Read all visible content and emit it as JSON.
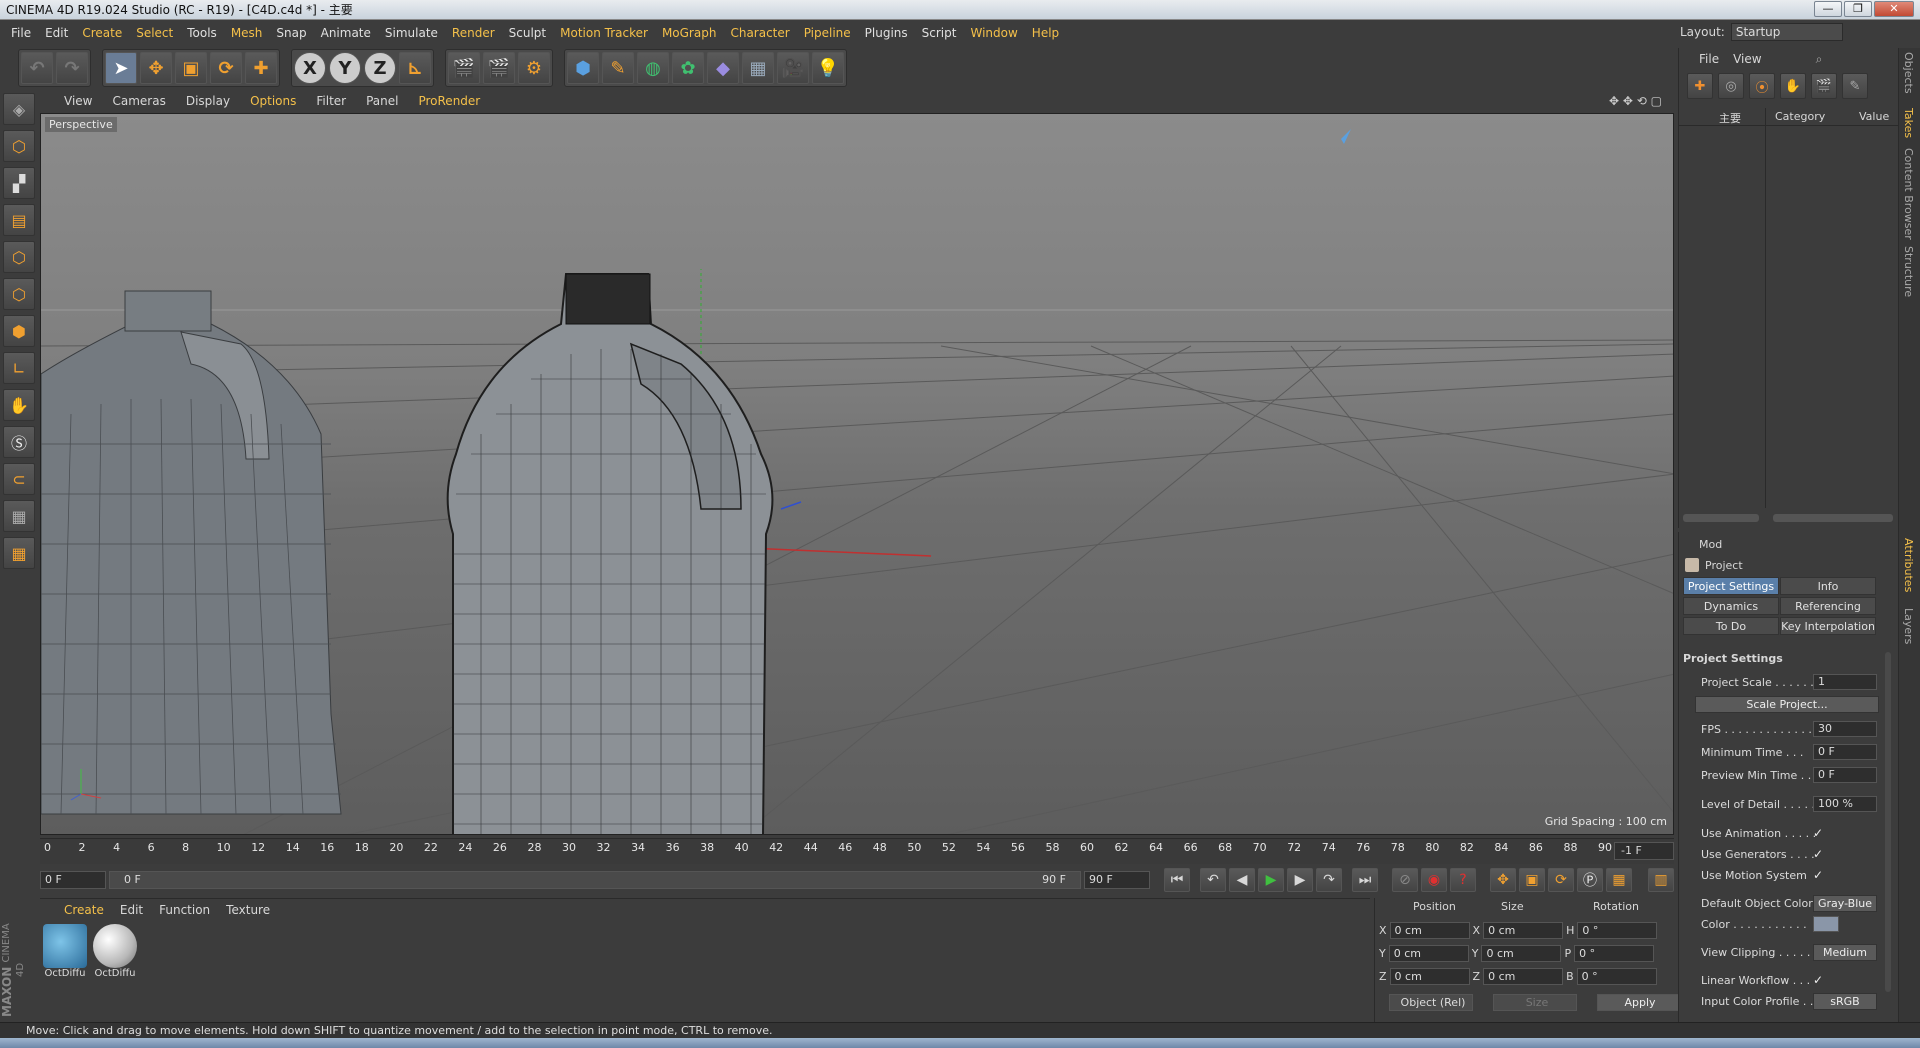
{
  "window": {
    "title": "CINEMA 4D R19.024 Studio (RC - R19) - [C4D.c4d *] - 主要",
    "buttons": [
      "—",
      "❐",
      "✕"
    ]
  },
  "menubar": {
    "items": [
      "File",
      "Edit",
      "Create",
      "Select",
      "Tools",
      "Mesh",
      "Snap",
      "Animate",
      "Simulate",
      "Render",
      "Sculpt",
      "Motion Tracker",
      "MoGraph",
      "Character",
      "Pipeline",
      "Plugins",
      "Script",
      "Window",
      "Help"
    ]
  },
  "layout": {
    "label": "Layout:",
    "value": "Startup"
  },
  "toolbar": {
    "axis_x": "X",
    "axis_y": "Y",
    "axis_z": "Z",
    "icons": [
      "undo-icon",
      "redo-icon",
      "select-icon",
      "move-icon",
      "scale-icon",
      "rotate-icon",
      "add-icon",
      "x-axis-icon",
      "y-axis-icon",
      "z-axis-icon",
      "coordinate-system-icon",
      "render-view-icon",
      "render-picture-viewer-icon",
      "render-settings-icon",
      "cube-icon",
      "pen-icon",
      "subdivision-icon",
      "cloner-icon",
      "deformer-icon",
      "floor-icon",
      "camera-icon",
      "light-icon"
    ]
  },
  "viewport": {
    "menu": [
      "View",
      "Cameras",
      "Display",
      "Options",
      "Filter",
      "Panel",
      "ProRender"
    ],
    "label": "Perspective",
    "grid_spacing": "Grid Spacing : 100 cm"
  },
  "timeline": {
    "ticks": [
      "0",
      "2",
      "4",
      "6",
      "8",
      "10",
      "12",
      "14",
      "16",
      "18",
      "20",
      "22",
      "24",
      "26",
      "28",
      "30",
      "32",
      "34",
      "36",
      "38",
      "40",
      "42",
      "44",
      "46",
      "48",
      "50",
      "52",
      "54",
      "56",
      "58",
      "60",
      "62",
      "64",
      "66",
      "68",
      "70",
      "72",
      "74",
      "76",
      "78",
      "80",
      "82",
      "84",
      "86",
      "88",
      "90"
    ],
    "current": "-1 F"
  },
  "playback": {
    "start": "0 F",
    "range_start": "0 F",
    "range_end": "90 F",
    "end": "90 F"
  },
  "material_manager": {
    "menu": [
      "Create",
      "Edit",
      "Function",
      "Texture"
    ],
    "materials": [
      {
        "name": "OctDiffu"
      },
      {
        "name": "OctDiffu"
      }
    ]
  },
  "coordinates": {
    "headers": [
      "Position",
      "Size",
      "Rotation"
    ],
    "rows": [
      {
        "axis": "X",
        "pos": "0 cm",
        "saxis": "X",
        "size": "0 cm",
        "raxis": "H",
        "rot": "0 °"
      },
      {
        "axis": "Y",
        "pos": "0 cm",
        "saxis": "Y",
        "size": "0 cm",
        "raxis": "P",
        "rot": "0 °"
      },
      {
        "axis": "Z",
        "pos": "0 cm",
        "saxis": "Z",
        "size": "0 cm",
        "raxis": "B",
        "rot": "0 °"
      }
    ],
    "mode": "Object (Rel)",
    "size_mode": "Size",
    "apply": "Apply"
  },
  "maxon": {
    "brand": "MAXON",
    "product": "CINEMA 4D"
  },
  "status": "Move: Click and drag to move elements. Hold down SHIFT to quantize movement / add to the selection in point mode, CTRL to remove.",
  "objects": {
    "menu": [
      "File",
      "View"
    ],
    "columns": {
      "name": "主要",
      "category": "Category",
      "value": "Value"
    }
  },
  "attributes": {
    "mode": "Mod",
    "object": "Project",
    "tabs": [
      "Project Settings",
      "Info",
      "Dynamics",
      "Referencing",
      "To Do",
      "Key Interpolation"
    ],
    "section": "Project Settings",
    "rows": [
      {
        "label": "Project Scale . . . . . . .",
        "value": "1",
        "kind": "field"
      },
      {
        "label": "",
        "value": "Scale Project...",
        "kind": "wide"
      },
      {
        "label": "FPS . . . . . . . . . . . . . .",
        "value": "30",
        "kind": "field"
      },
      {
        "label": "Minimum Time . . .",
        "value": "0 F",
        "kind": "field"
      },
      {
        "label": "Preview Min Time . . .",
        "value": "0 F",
        "kind": "field"
      },
      {
        "label": "Level of Detail . . . . .",
        "value": "100 %",
        "kind": "field"
      },
      {
        "label": "Use Animation . . . . .",
        "value": "✓",
        "kind": "check"
      },
      {
        "label": "Use Generators . . . .",
        "value": "✓",
        "kind": "check"
      },
      {
        "label": "Use Motion System",
        "value": "✓",
        "kind": "check"
      },
      {
        "label": "Default Object Color",
        "value": "Gray-Blue",
        "kind": "button"
      },
      {
        "label": "Color . . . . . . . . . . .",
        "value": "",
        "kind": "swatch"
      },
      {
        "label": "View Clipping . . . . .",
        "value": "Medium",
        "kind": "button"
      },
      {
        "label": "Linear Workflow . . .",
        "value": "✓",
        "kind": "check"
      },
      {
        "label": "Input Color Profile . .",
        "value": "sRGB",
        "kind": "button"
      }
    ]
  },
  "side_tabs": [
    "Objects",
    "Takes",
    "Content Browser",
    "Structure",
    "Attributes",
    "Layers"
  ],
  "colors": {
    "accent": "#f4c04a",
    "active_tab": "#5a7fa9",
    "bg": "#3c3c3c",
    "swatch": "#8a96a8"
  }
}
